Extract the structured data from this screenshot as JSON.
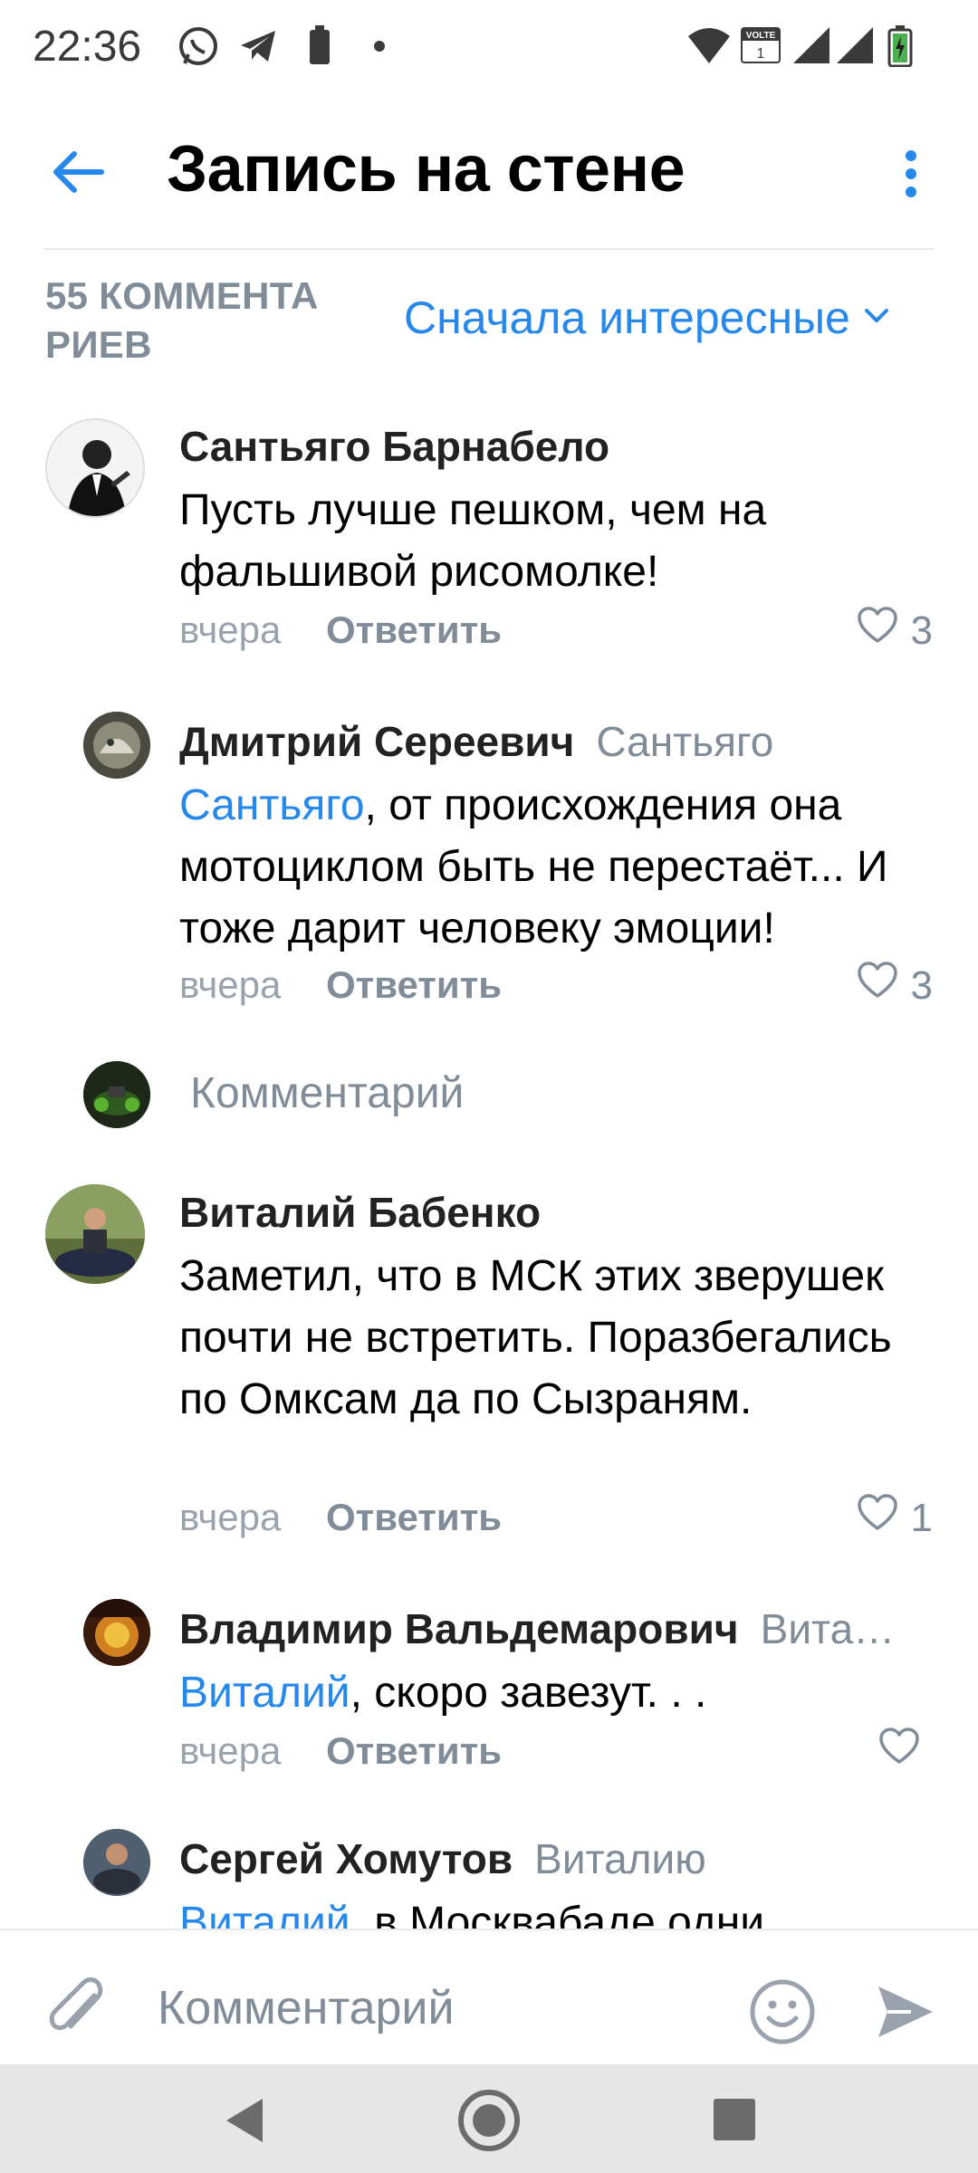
{
  "status_bar": {
    "time": "22:36",
    "icons": [
      "whatsapp-icon",
      "telegram-icon",
      "battery-saver-icon",
      "dot-icon",
      "wifi-icon",
      "volte-icon",
      "signal-icon",
      "signal-icon",
      "battery-icon"
    ],
    "volte_label": "VOLTE"
  },
  "app_bar": {
    "title": "Запись на стене"
  },
  "comments_header": {
    "count_label": "55 КОММЕНТА РИЕВ",
    "sort_label": "Сначала интересные"
  },
  "comments": [
    {
      "author": "Сантьяго Барнабело",
      "reply_to": "",
      "mention": "",
      "text": "Пусть лучше пешком, чем на фальшивой рисомолке!",
      "time": "вчера",
      "reply_label": "Ответить",
      "likes": "3"
    },
    {
      "author": "Дмитрий Сереевич",
      "reply_to": "Сантьяго",
      "mention": "Сантьяго",
      "text": ", от происхождения она мотоциклом быть не перестаёт... И тоже дарит человеку эмоции!",
      "time": "вчера",
      "reply_label": "Ответить",
      "likes": "3"
    },
    {
      "author": "Виталий Бабенко",
      "reply_to": "",
      "mention": "",
      "text": "Заметил, что в МСК этих зверушек почти не встретить. Поразбегались по Омксам да по Сызраням.",
      "time": "вчера",
      "reply_label": "Ответить",
      "likes": "1"
    },
    {
      "author": "Владимир Вальдемарович",
      "reply_to": "Вита…",
      "mention": "Виталий",
      "text": ", скоро завезут. . .",
      "time": "вчера",
      "reply_label": "Ответить",
      "likes": ""
    },
    {
      "author": "Сергей Хомутов",
      "reply_to": "Виталию",
      "mention": "Виталий",
      "text": ", в Москвабаде одни",
      "time": "",
      "reply_label": "",
      "likes": ""
    }
  ],
  "inline_reply": {
    "placeholder": "Комментарий"
  },
  "composer": {
    "placeholder": "Комментарий"
  },
  "colors": {
    "accent": "#2688eb",
    "secondary_text": "#818c99",
    "divider": "#e7e8ec"
  }
}
